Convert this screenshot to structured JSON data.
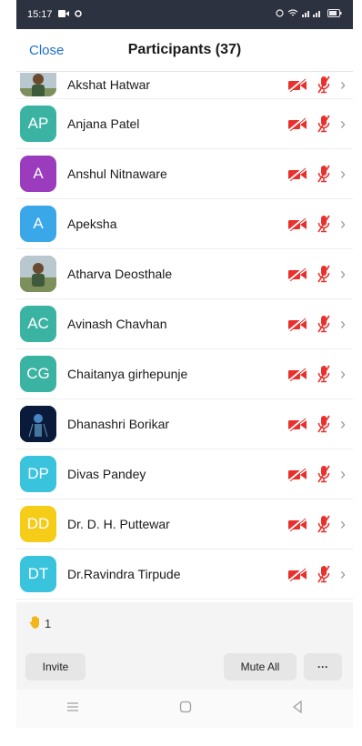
{
  "status_bar": {
    "time": "15:17"
  },
  "header": {
    "close_label": "Close",
    "title": "Participants (37)"
  },
  "participants": [
    {
      "name": "Akshat Hatwar",
      "initials": "",
      "avatar_color": "#8a6b3d",
      "avatar_type": "photo"
    },
    {
      "name": "Anjana Patel",
      "initials": "AP",
      "avatar_color": "#3bb3a3",
      "avatar_type": "initials"
    },
    {
      "name": "Anshul Nitnaware",
      "initials": "A",
      "avatar_color": "#9b3bbd",
      "avatar_type": "initials"
    },
    {
      "name": "Apeksha",
      "initials": "A",
      "avatar_color": "#3aa7e8",
      "avatar_type": "initials"
    },
    {
      "name": "Atharva Deosthale",
      "initials": "",
      "avatar_color": "#5b6b4a",
      "avatar_type": "photo"
    },
    {
      "name": "Avinash Chavhan",
      "initials": "AC",
      "avatar_color": "#3bb3a3",
      "avatar_type": "initials"
    },
    {
      "name": "Chaitanya girhepunje",
      "initials": "CG",
      "avatar_color": "#3bb3a3",
      "avatar_type": "initials"
    },
    {
      "name": "Dhanashri Borikar",
      "initials": "",
      "avatar_color": "#0a1a3a",
      "avatar_type": "image"
    },
    {
      "name": "Divas Pandey",
      "initials": "DP",
      "avatar_color": "#39c3dc",
      "avatar_type": "initials"
    },
    {
      "name": "Dr. D. H. Puttewar",
      "initials": "DD",
      "avatar_color": "#f5cc18",
      "avatar_type": "initials"
    },
    {
      "name": "Dr.Ravindra Tirpude",
      "initials": "DT",
      "avatar_color": "#39c3dc",
      "avatar_type": "initials"
    }
  ],
  "footer": {
    "raised_hands_count": "1",
    "invite_label": "Invite",
    "mute_all_label": "Mute All",
    "more_label": "···"
  },
  "colors": {
    "muted_red": "#e8302c",
    "link_blue": "#1f6fd1"
  }
}
